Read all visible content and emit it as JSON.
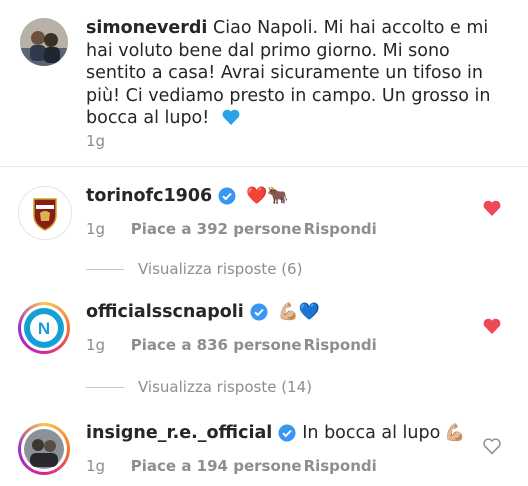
{
  "caption": {
    "username": "simoneverdi",
    "text": "Ciao Napoli. Mi hai accolto e mi hai voluto bene dal primo giorno. Mi sono sentito a casa! Avrai sicuramente un tifoso in più! Ci vediamo presto in campo. Un grosso in bocca al lupo!",
    "time": "1g"
  },
  "comments": [
    {
      "username": "torinofc1906",
      "text": "",
      "emojis": "❤️🐂",
      "time": "1g",
      "likes": "Piace a 392 persone",
      "reply": "Rispondi",
      "liked": true,
      "replies": "Visualizza risposte (6)"
    },
    {
      "username": "officialsscnapoli",
      "text": "",
      "emojis": "💪🏼💙",
      "time": "1g",
      "likes": "Piace a 836 persone",
      "reply": "Rispondi",
      "liked": true,
      "replies": "Visualizza risposte (14)"
    },
    {
      "username": "insigne_r.e._official",
      "text": "In bocca al lupo",
      "emojis": "💪🏼",
      "time": "1g",
      "likes": "Piace a 194 persone",
      "reply": "Rispondi",
      "liked": false
    }
  ],
  "colors": {
    "heart_liked": "#ed4956",
    "verified": "#3897f0",
    "meta_text": "#8e8e8e",
    "torino_red": "#8b1a1a",
    "napoli_blue": "#12a0d7"
  }
}
